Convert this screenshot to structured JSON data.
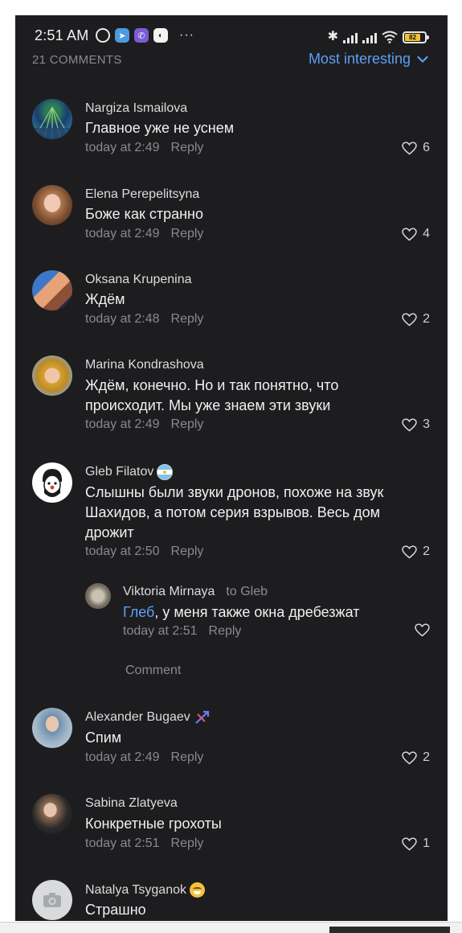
{
  "status_bar": {
    "time": "2:51 AM",
    "left_icons": [
      "alarm-icon",
      "telegram-icon",
      "viber-icon",
      "messenger-icon"
    ],
    "more": "···",
    "battery_level": "82",
    "right_icons": [
      "bluetooth-icon",
      "signal-icon",
      "signal-icon",
      "wifi-icon",
      "battery-icon"
    ]
  },
  "header": {
    "count_label": "21 COMMENTS",
    "sort_label": "Most interesting",
    "accent_color": "#5d9ff5"
  },
  "comments": [
    {
      "author": "Nargiza Ismailova",
      "text": "Главное уже не уснем",
      "time": "today at 2:49",
      "reply": "Reply",
      "likes": "6"
    },
    {
      "author": "Elena Perepelitsyna",
      "text": "Боже как странно",
      "time": "today at 2:49",
      "reply": "Reply",
      "likes": "4"
    },
    {
      "author": "Oksana Krupenina",
      "text": "Ждём",
      "time": "today at 2:48",
      "reply": "Reply",
      "likes": "2"
    },
    {
      "author": "Marina Kondrashova",
      "text": "Ждём,  конечно.  Но и так понятно, что происходит. Мы уже знаем эти звуки",
      "time": "today at 2:49",
      "reply": "Reply",
      "likes": "3"
    },
    {
      "author": "Gleb Filatov",
      "text": "Слышны были звуки дронов, похоже на звук Шахидов, а потом серия взрывов. Весь дом дрожит",
      "time": "today at 2:50",
      "reply": "Reply",
      "likes": "2",
      "badge": "argentina-flag-emoji"
    },
    {
      "author": "Alexander Bugaev",
      "text": "Спим",
      "time": "today at 2:49",
      "reply": "Reply",
      "likes": "2",
      "badge": "sagittarius-bow-emoji"
    },
    {
      "author": "Sabina Zlatyeva",
      "text": "Конкретные грохоты",
      "time": "today at 2:51",
      "reply": "Reply",
      "likes": "1"
    },
    {
      "author": "Natalya Tsyganok",
      "text": "Страшно",
      "badge": "grimacing-face-emoji"
    }
  ],
  "nested_reply": {
    "author": "Viktoria Mirnaya",
    "to": "to Gleb",
    "mention": "Глеб",
    "text": ", у меня также окна дребезжат",
    "time": "today at 2:51",
    "reply": "Reply"
  },
  "comment_link": "Comment"
}
